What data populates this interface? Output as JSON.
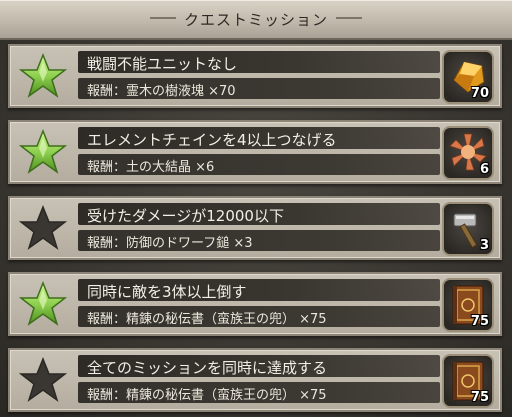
{
  "header": {
    "title": "クエストミッション"
  },
  "missions": [
    {
      "title": "戦闘不能ユニットなし",
      "reward": "報酬：霊木の樹液塊 ×70",
      "count": "70",
      "achieved": true,
      "item_icon": "tree-sap-gem-icon"
    },
    {
      "title": "エレメントチェインを4以上つなげる",
      "reward": "報酬：土の大結晶 ×6",
      "count": "6",
      "achieved": true,
      "item_icon": "earth-crystal-icon"
    },
    {
      "title": "受けたダメージが12000以下",
      "reward": "報酬：防御のドワーフ鎚 ×3",
      "count": "3",
      "achieved": false,
      "item_icon": "dwarf-hammer-icon"
    },
    {
      "title": "同時に敵を3体以上倒す",
      "reward": "報酬：精錬の秘伝書（蛮族王の兜） ×75",
      "count": "75",
      "achieved": true,
      "item_icon": "secret-book-icon"
    },
    {
      "title": "全てのミッションを同時に達成する",
      "reward": "報酬：精錬の秘伝書（蛮族王の兜） ×75",
      "count": "75",
      "achieved": false,
      "item_icon": "secret-book-icon"
    }
  ],
  "colors": {
    "star_achieved": "#8fd14f",
    "star_empty": "#3a3733",
    "panel_dark": "#2e2b27"
  }
}
